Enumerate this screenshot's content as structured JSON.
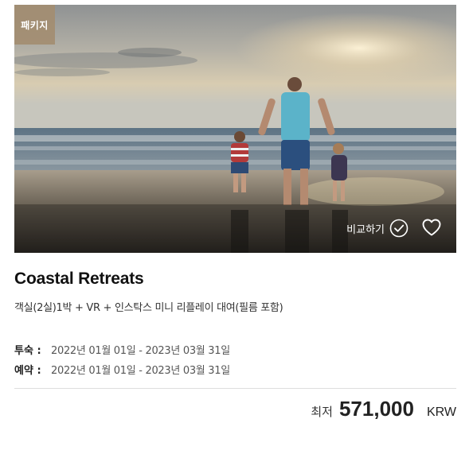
{
  "badge": "패키지",
  "compare_label": "비교하기",
  "title": "Coastal Retreats",
  "subtitle": "객실(2실)1박 + VR + 인스탁스 미니 리플레이 대여(필름 포함)",
  "periods": [
    {
      "label": "투숙 :",
      "value": "2022년 01월 01일 - 2023년 03월 31일"
    },
    {
      "label": "예약 :",
      "value": "2022년 01월 01일 - 2023년 03월 31일"
    }
  ],
  "price": {
    "prefix": "최저",
    "value": "571,000",
    "currency": "KRW"
  },
  "icons": {
    "compare": "check-circle-icon",
    "wishlist": "heart-icon"
  },
  "colors": {
    "badge_bg": "#a38d71",
    "overlay": "rgba(0,0,0,0.28)",
    "divider": "#dddddd"
  }
}
